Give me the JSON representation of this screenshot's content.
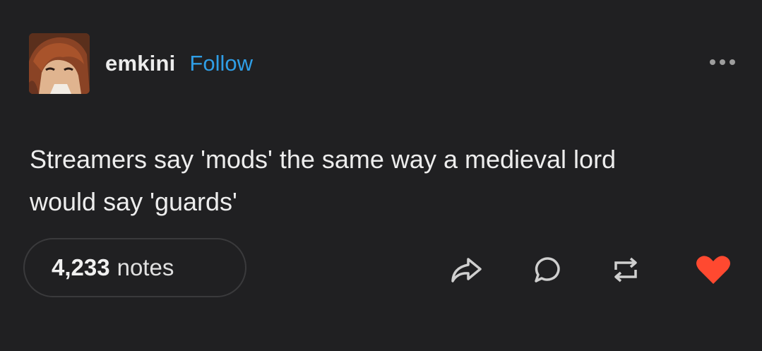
{
  "post": {
    "username": "emkini",
    "follow_label": "Follow",
    "text": "Streamers say 'mods' the same way a medieval lord\nwould say 'guards'",
    "notes_count": "4,233",
    "notes_label": "notes"
  },
  "icons": {
    "menu": "more-options-icon",
    "share": "share-icon",
    "reply": "reply-icon",
    "reblog": "reblog-icon",
    "like": "heart-icon"
  },
  "colors": {
    "background": "#202022",
    "follow": "#2f9ee6",
    "like": "#ff4930",
    "icon": "#cfcfcf"
  }
}
